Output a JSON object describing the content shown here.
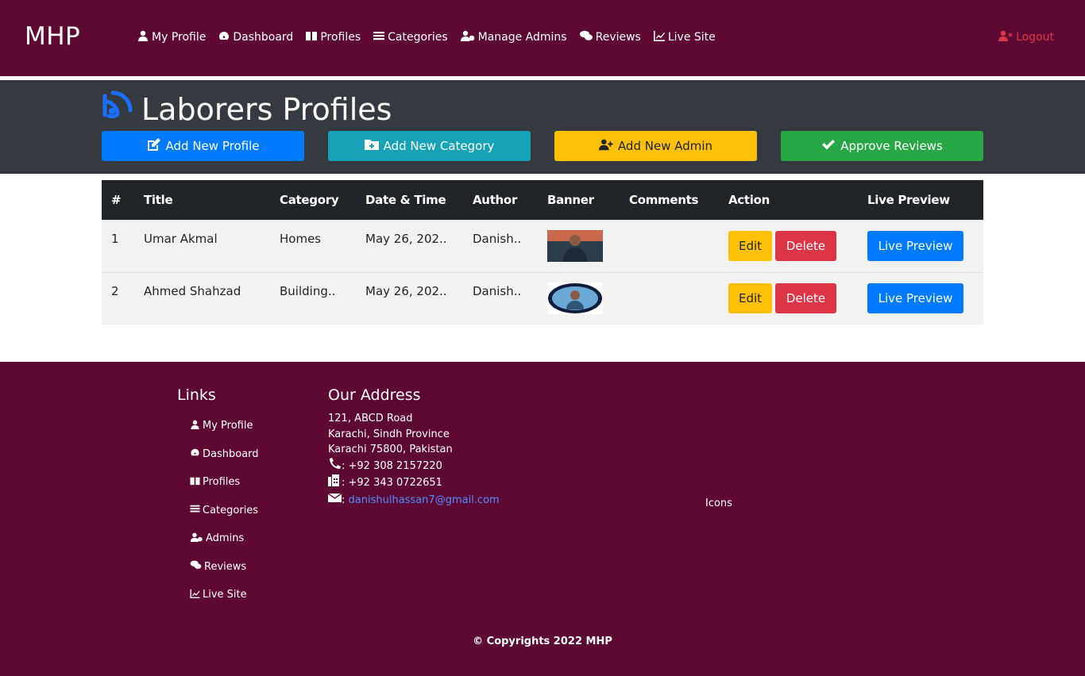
{
  "navbar": {
    "brand": "MHP",
    "items": [
      {
        "label": "My Profile",
        "icon": "user-icon"
      },
      {
        "label": "Dashboard",
        "icon": "tachometer-icon"
      },
      {
        "label": "Profiles",
        "icon": "book-icon"
      },
      {
        "label": "Categories",
        "icon": "bars-icon"
      },
      {
        "label": "Manage Admins",
        "icon": "user-cog-icon"
      },
      {
        "label": "Reviews",
        "icon": "comments-icon"
      },
      {
        "label": "Live Site",
        "icon": "chart-line-icon"
      }
    ],
    "logout_label": "Logout"
  },
  "header": {
    "title": "Laborers Profiles",
    "buttons": {
      "add_profile": "Add New Profile",
      "add_category": "Add New Category",
      "add_admin": "Add New Admin",
      "approve_reviews": "Approve Reviews"
    }
  },
  "table": {
    "headers": [
      "#",
      "Title",
      "Category",
      "Date & Time",
      "Author",
      "Banner",
      "Comments",
      "Action",
      "Live Preview"
    ],
    "rows": [
      {
        "num": "1",
        "title": "Umar Akmal",
        "category": "Homes",
        "datetime": "May 26, 202..",
        "author": "Danish..",
        "banner": "banner-photo-1",
        "comments": "",
        "edit": "Edit",
        "delete": "Delete",
        "preview": "Live Preview"
      },
      {
        "num": "2",
        "title": "Ahmed Shahzad",
        "category": "Building..",
        "datetime": "May 26, 202..",
        "author": "Danish..",
        "banner": "banner-photo-2",
        "comments": "",
        "edit": "Edit",
        "delete": "Delete",
        "preview": "Live Preview"
      }
    ]
  },
  "footer": {
    "links_heading": "Links",
    "links": [
      "My Profile",
      "Dashboard",
      "Profiles",
      "Categories",
      "Admins",
      "Reviews",
      "Live Site"
    ],
    "address_heading": "Our Address",
    "address_lines": [
      "121, ABCD Road",
      "Karachi, Sindh Province",
      "Karachi 75800, Pakistan"
    ],
    "phone": ": +92 308 2157220",
    "fax": ": +92 343 0722651",
    "email_prefix": ":",
    "email": "danishulhassan7@gmail.com",
    "icons_text": "Icons",
    "copyright": "© Copyrights 2022 MHP"
  },
  "colors": {
    "brand_maroon": "#5e0933",
    "header_dark": "#343a40",
    "primary": "#007bff",
    "info": "#17a2b8",
    "warning": "#ffc107",
    "success": "#28a745",
    "danger": "#dc3545"
  }
}
